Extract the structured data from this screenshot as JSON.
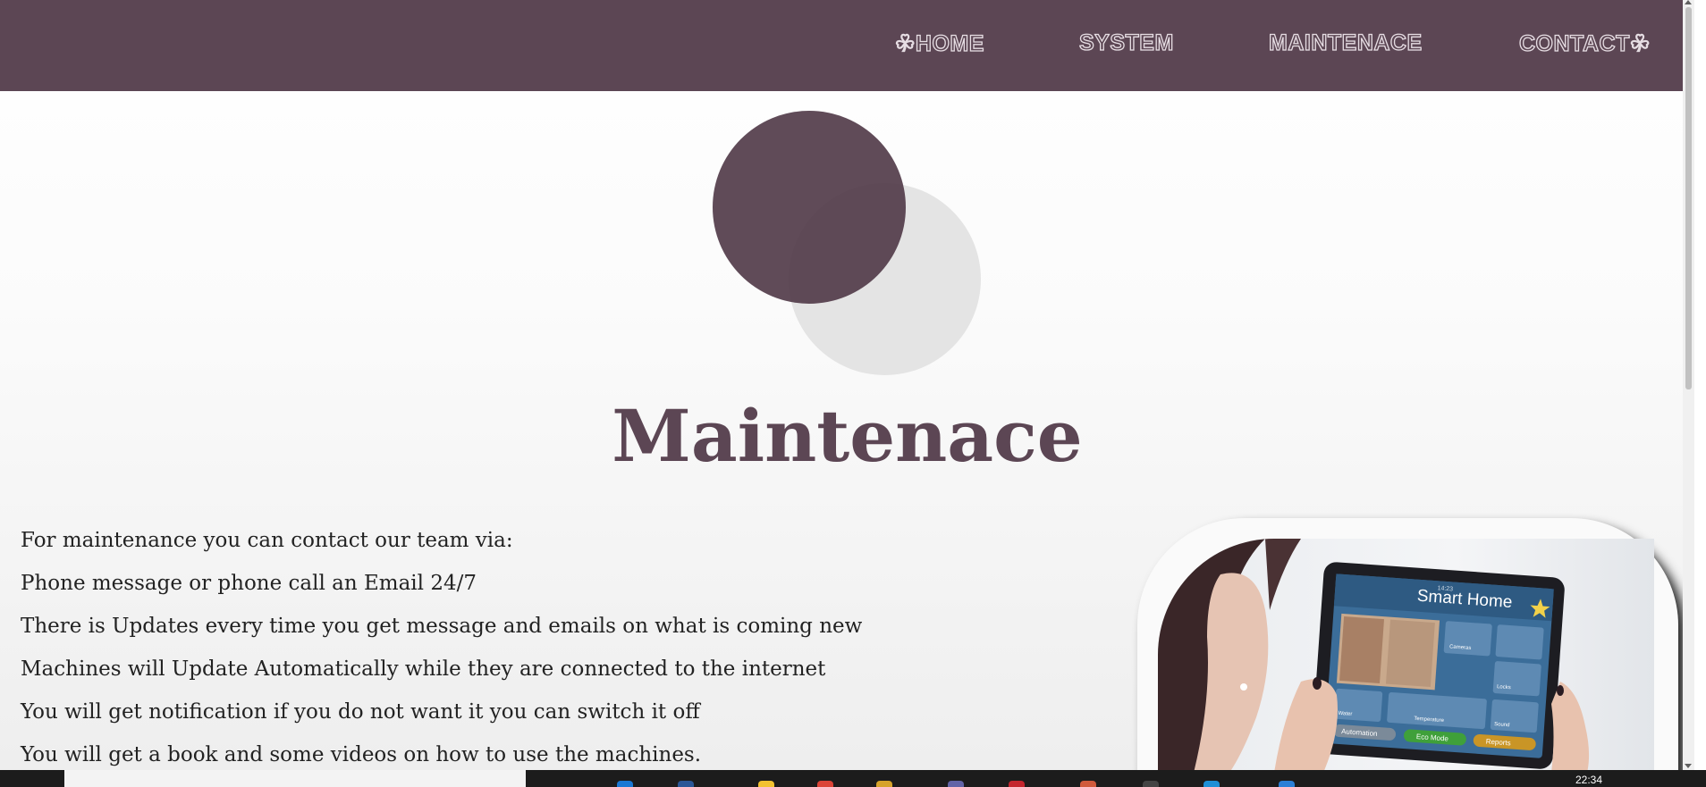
{
  "nav": {
    "home": "☘HOME",
    "system": "SYSTEM",
    "maintenance": "MAINTENACE",
    "contact": "CONTACT☘"
  },
  "page": {
    "title": "Maintenace",
    "paragraphs": [
      "For maintenance you can contact our team via:",
      "Phone message or phone call an Email 24/7",
      "There is Updates every time you get message and emails on what is coming new",
      "Machines will Update Automatically while they are connected to the internet",
      "You will get notification if you do not want it you can switch it off",
      "You will get a book and some videos on how to use the machines."
    ]
  },
  "photo": {
    "tablet_title": "Smart Home",
    "tablet_time": "14:23",
    "tiles": [
      "Cameras",
      "Locks",
      "Sound",
      "Water",
      "Temperature"
    ],
    "buttons": [
      "Automation",
      "Eco Mode",
      "Reports"
    ]
  },
  "taskbar": {
    "clock": "22:34"
  },
  "colors": {
    "brand": "#5c4654",
    "nav_text_outline": "#e6dde3",
    "circle_light": "#e4e4e4"
  }
}
